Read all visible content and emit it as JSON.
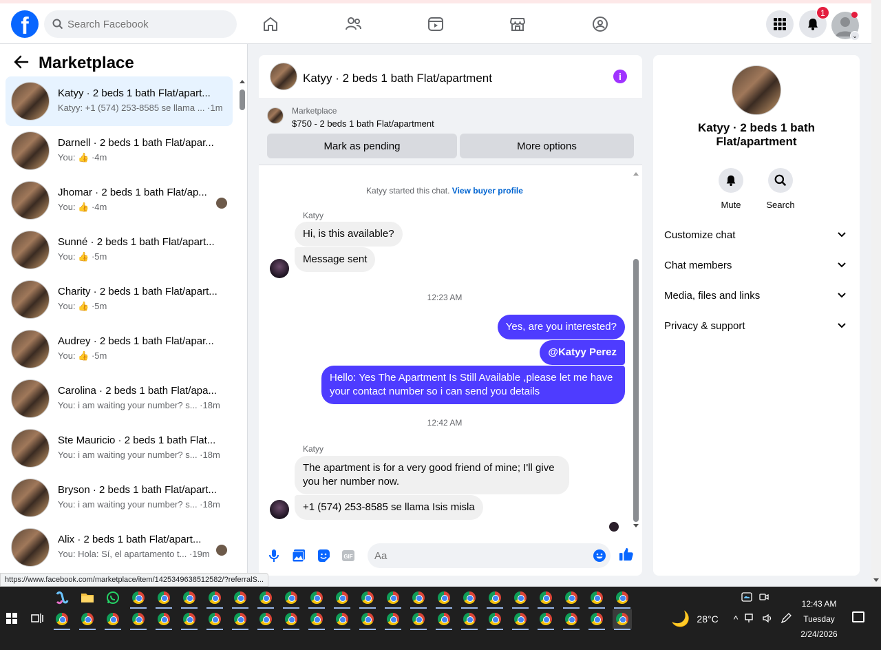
{
  "topbar": {
    "logo_letter": "f",
    "search_placeholder": "Search Facebook",
    "notification_count": "1"
  },
  "left": {
    "title": "Marketplace",
    "conversations": [
      {
        "title": "Katyy · 2 beds 1 bath Flat/apart...",
        "sub": "Katyy: +1 (574) 253-8585 se llama ... ·1m",
        "active": true
      },
      {
        "title": "Darnell · 2 beds 1 bath Flat/apar...",
        "sub": "You: 👍 ·4m"
      },
      {
        "title": "Jhomar · 2 beds 1 bath Flat/ap...",
        "sub": "You: 👍 ·4m",
        "mini_avatar": true
      },
      {
        "title": "Sunné · 2 beds 1 bath Flat/apart...",
        "sub": "You: 👍 ·5m"
      },
      {
        "title": "Charity · 2 beds 1 bath Flat/apart...",
        "sub": "You: 👍 ·5m"
      },
      {
        "title": "Audrey · 2 beds 1 bath Flat/apar...",
        "sub": "You: 👍 ·5m"
      },
      {
        "title": "Carolina · 2 beds 1 bath Flat/apa...",
        "sub": "You: i am waiting your number? s... ·18m"
      },
      {
        "title": "Ste Mauricio · 2 beds 1 bath Flat...",
        "sub": "You: i am waiting your number? s... ·18m"
      },
      {
        "title": "Bryson · 2 beds 1 bath Flat/apart...",
        "sub": "You: i am waiting your number? s... ·18m"
      },
      {
        "title": "Alix · 2 beds 1 bath Flat/apart...",
        "sub": "You: Hola: Sí, el apartamento t... ·19m",
        "mini_avatar": true
      }
    ]
  },
  "chat": {
    "title": "Katyy · 2 beds 1 bath Flat/apartment",
    "marketplace_label": "Marketplace",
    "listing": "$750 - 2 beds 1 bath Flat/apartment",
    "mark_pending": "Mark as pending",
    "more_options": "More options",
    "started_text": "Katyy started this chat.",
    "view_profile": "View buyer profile",
    "sender": "Katyy",
    "msg1": "Hi, is this available?",
    "msg2": "Message sent",
    "time1": "12:23 AM",
    "out1": "Yes, are you interested?",
    "out2": "@Katyy Perez",
    "out3": "Hello: Yes The Apartment Is Still Available ,please let me have your contact number so i can send you details",
    "time2": "12:42 AM",
    "msg3": "The apartment is for a very good friend of mine; I'll give you her number now.",
    "msg4": "+1 (574) 253-8585 se llama Isis misla",
    "composer_placeholder": "Aa"
  },
  "right": {
    "title": "Katyy · 2 beds 1 bath Flat/apartment",
    "mute": "Mute",
    "search": "Search",
    "menu": [
      "Customize chat",
      "Chat members",
      "Media, files and links",
      "Privacy & support"
    ]
  },
  "status_url": "https://www.facebook.com/marketplace/item/1425349638512582/?referralS...",
  "taskbar": {
    "temperature": "28°C",
    "time": "12:43 AM",
    "day": "Tuesday",
    "date": "2/24/2026"
  },
  "colors": {
    "brand": "#0866ff",
    "outgoing_bubble": "#4e3cff",
    "accent_purple": "#a033ff",
    "badge_red": "#e41e3f"
  }
}
